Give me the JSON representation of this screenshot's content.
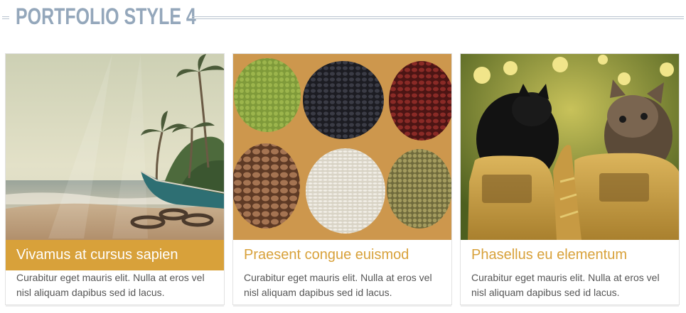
{
  "section": {
    "title": "PORTFOLIO STYLE 4"
  },
  "colors": {
    "accent": "#d8a13a",
    "heading": "#94a7bb",
    "body_text": "#555555"
  },
  "items": [
    {
      "image": "beach-boat-palm-trees-photo",
      "title": "Vivamus at cursus sapien",
      "description": "Curabitur eget mauris elit. Nulla at eros vel nisl aliquam dapibus sed id lacus.",
      "highlighted": true
    },
    {
      "image": "beans-and-grains-photo",
      "title": "Praesent congue euismod",
      "description": "Curabitur eget mauris elit. Nulla at eros vel nisl aliquam dapibus sed id lacus.",
      "highlighted": false
    },
    {
      "image": "kittens-in-boots-photo",
      "title": "Phasellus eu elementum",
      "description": "Curabitur eget mauris elit. Nulla at eros vel nisl aliquam dapibus sed id lacus.",
      "highlighted": false
    }
  ]
}
